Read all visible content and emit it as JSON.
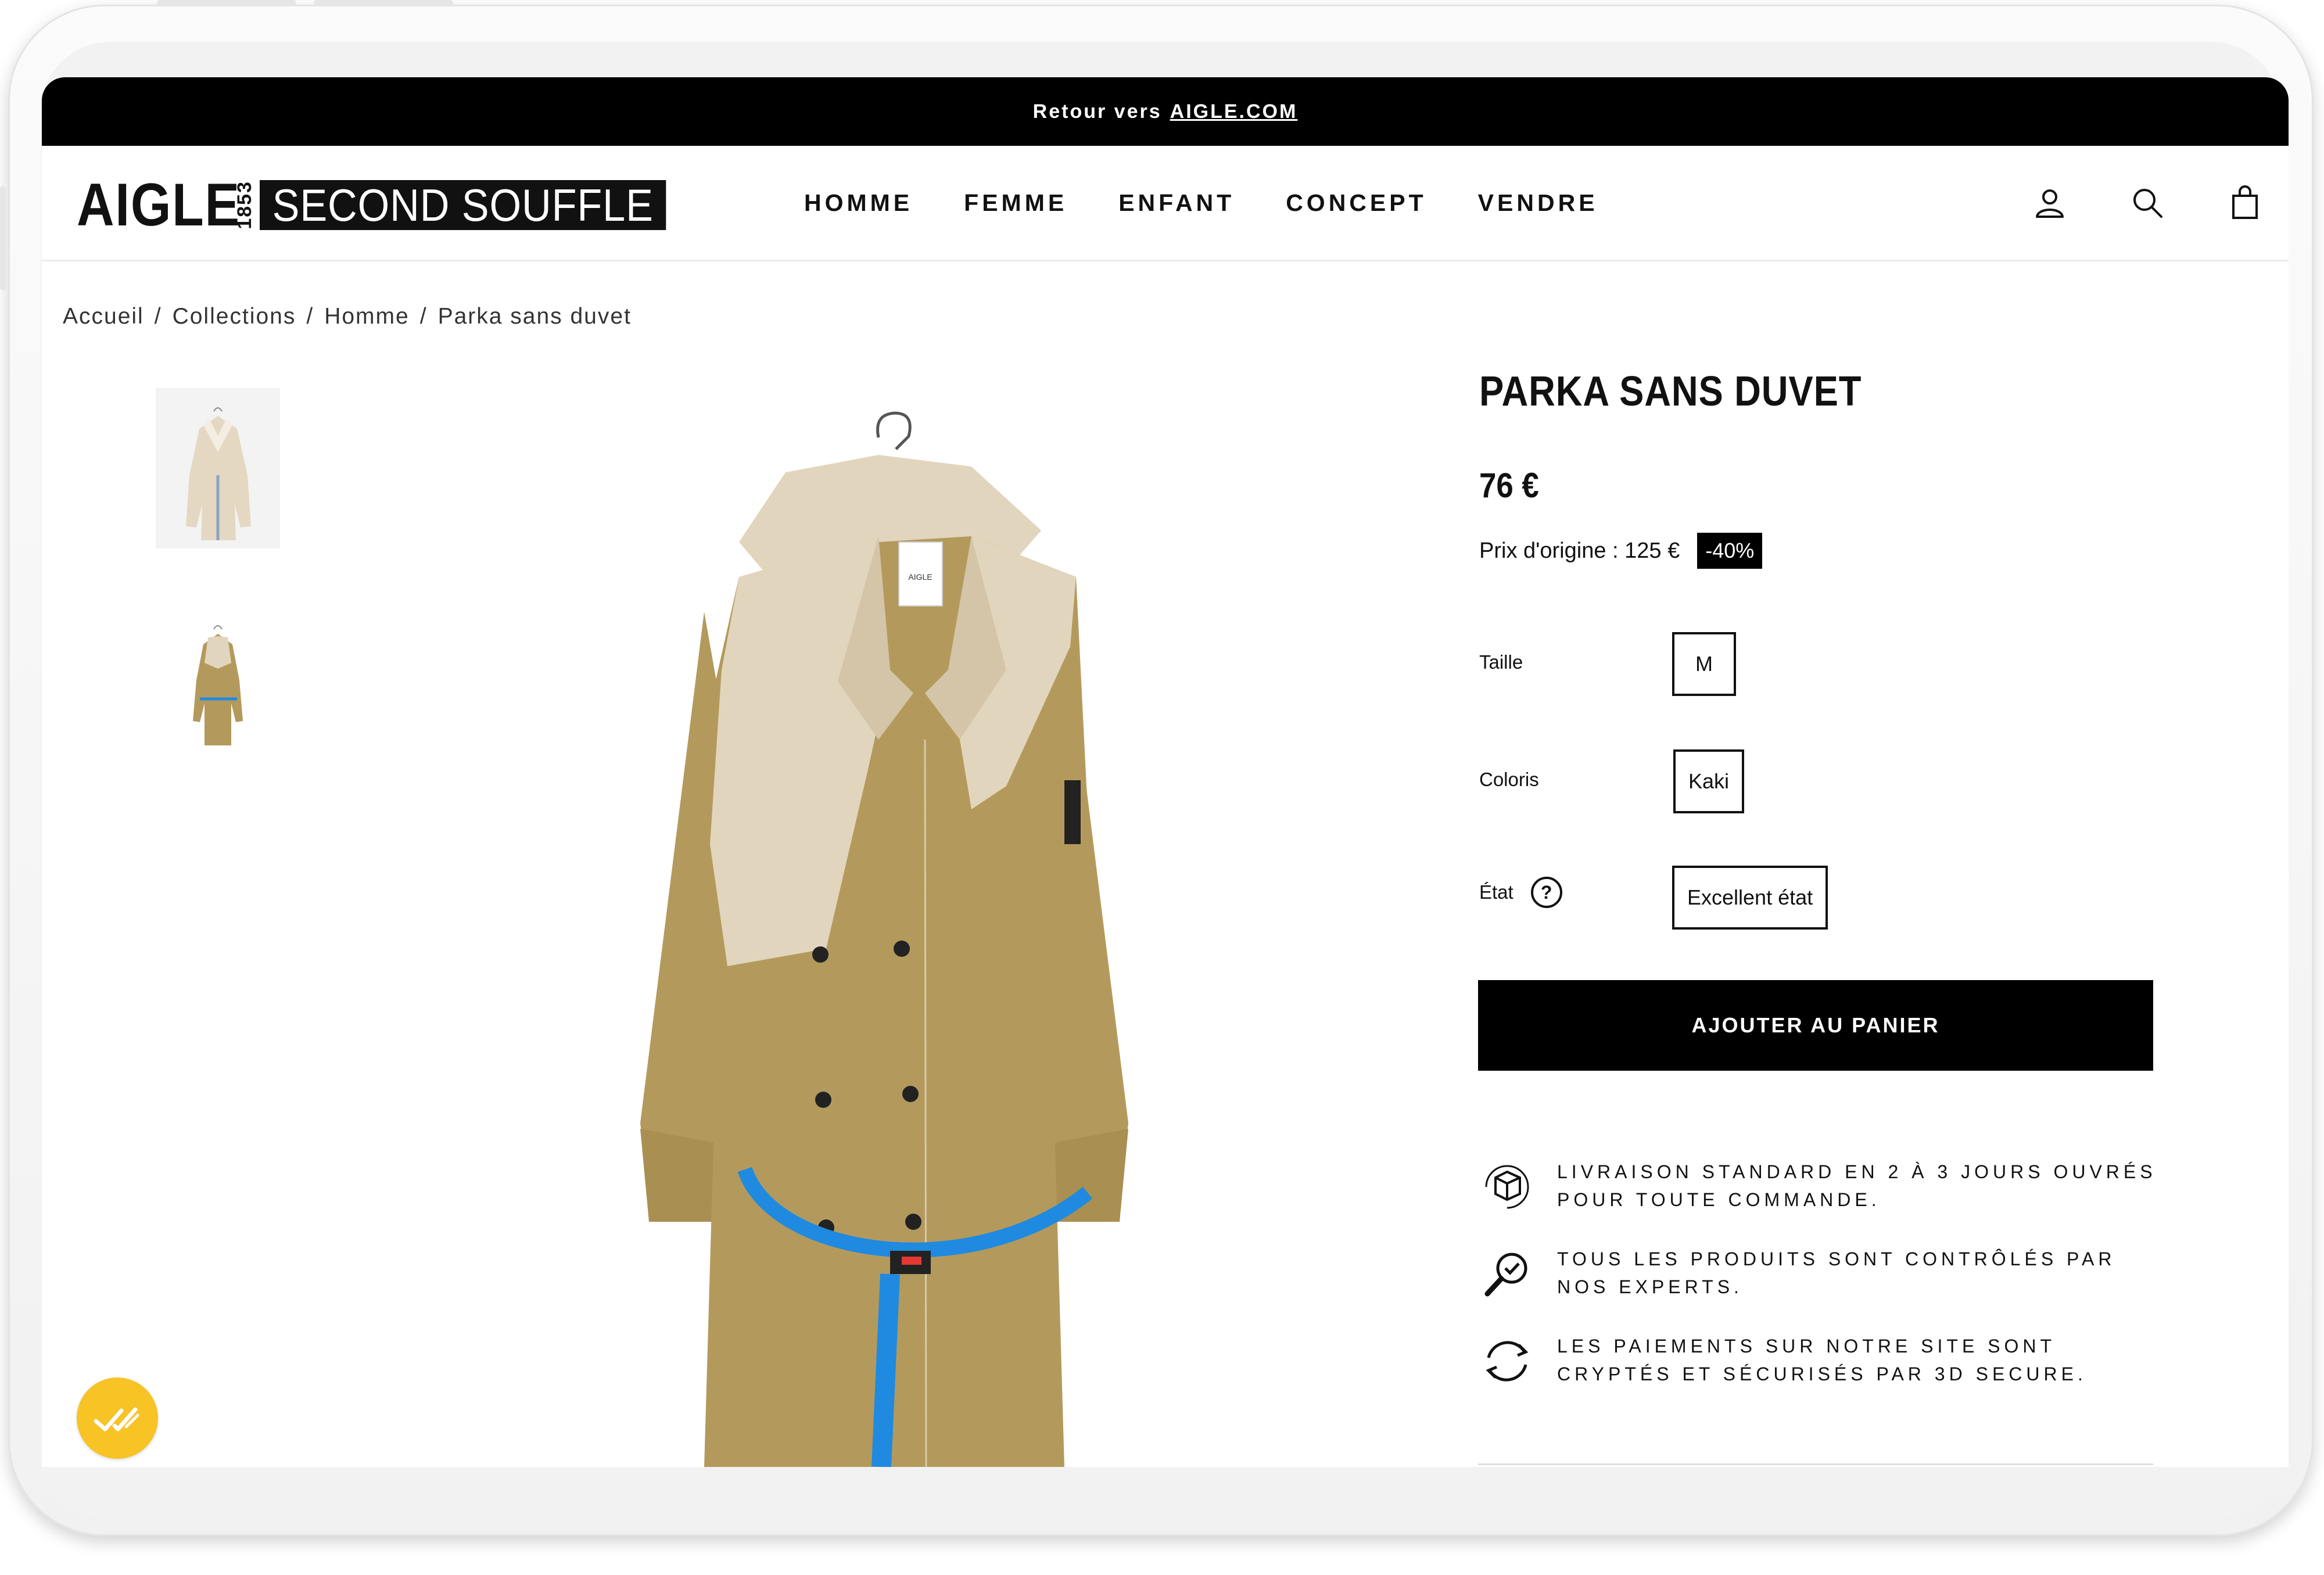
{
  "banner": {
    "prefix": "Retour vers",
    "link": "AIGLE.COM"
  },
  "logo": {
    "brand": "AIGLE",
    "year": "1853",
    "tagline": "SECOND SOUFFLE"
  },
  "nav": [
    "HOMME",
    "FEMME",
    "ENFANT",
    "CONCEPT",
    "VENDRE"
  ],
  "header_icons": [
    "account-icon",
    "search-icon",
    "cart-icon"
  ],
  "breadcrumb": [
    "Accueil",
    "Collections",
    "Homme",
    "Parka sans duvet"
  ],
  "product": {
    "title": "PARKA SANS DUVET",
    "price": "76 €",
    "original_price": "Prix d'origine : 125 €",
    "discount": "-40%",
    "size_label": "Taille",
    "size_value": "M",
    "color_label": "Coloris",
    "color_value": "Kaki",
    "condition_label": "État",
    "condition_help": "?",
    "condition_value": "Excellent état",
    "add_to_cart": "AJOUTER AU PANIER"
  },
  "reassurance": [
    {
      "icon": "delivery-box-icon",
      "text": "LIVRAISON STANDARD EN 2 À 3 JOURS OUVRÉS POUR TOUTE COMMANDE."
    },
    {
      "icon": "magnifier-check-icon",
      "text": "TOUS LES PRODUITS SONT CONTRÔLÉS PAR NOS EXPERTS."
    },
    {
      "icon": "refresh-arrows-icon",
      "text": "LES PAIEMENTS SUR NOTRE SITE SONT CRYPTÉS ET SÉCURISÉS PAR 3D SECURE."
    }
  ],
  "garment_tag": "AIGLE",
  "colors": {
    "khaki": "#b39a5c",
    "beige": "#e2d5bd",
    "strap_blue": "#1f8ae0",
    "fab_yellow": "#f7c325"
  }
}
